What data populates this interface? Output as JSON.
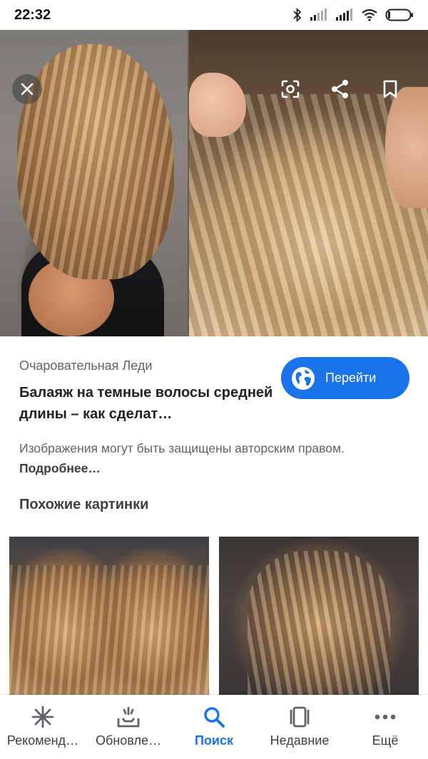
{
  "status_bar": {
    "time": "22:32",
    "icons": [
      "bluetooth-icon",
      "signal-icon",
      "signal-icon",
      "wifi-icon",
      "battery-icon"
    ]
  },
  "hero": {
    "buttons": [
      "close-icon",
      "lens-icon",
      "share-icon",
      "bookmark-icon"
    ]
  },
  "result": {
    "source": "Очаровательная Леди",
    "title": "Балаяж на темные волосы средней длины – как сделат…",
    "visit_label": "Перейти",
    "copyright_text": "Изображения могут быть защищены авторским правом.",
    "copyright_link": "Подробнее…"
  },
  "similar": {
    "heading": "Похожие картинки"
  },
  "bottom_nav": {
    "items": [
      {
        "label": "Рекоменд…",
        "icon": "asterisk-icon"
      },
      {
        "label": "Обновле…",
        "icon": "updates-icon"
      },
      {
        "label": "Поиск",
        "icon": "search-icon"
      },
      {
        "label": "Недавние",
        "icon": "recent-icon"
      },
      {
        "label": "Ещё",
        "icon": "more-icon"
      }
    ],
    "active": "Поиск"
  },
  "colors": {
    "accent": "#1a73e8",
    "text_primary": "#202124",
    "text_secondary": "#5f6368"
  }
}
